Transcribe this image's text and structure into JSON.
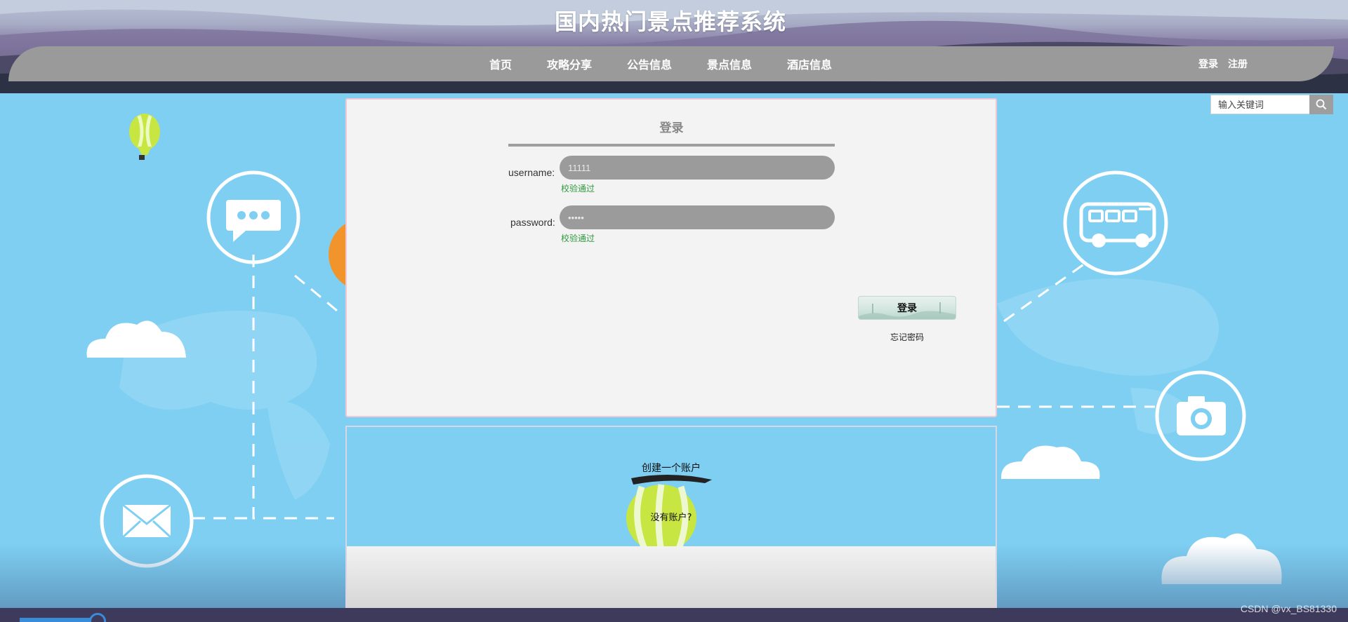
{
  "site": {
    "title": "国内热门景点推荐系统"
  },
  "nav": {
    "items": [
      {
        "label": "首页"
      },
      {
        "label": "攻略分享"
      },
      {
        "label": "公告信息"
      },
      {
        "label": "景点信息"
      },
      {
        "label": "酒店信息"
      }
    ],
    "login_label": "登录",
    "register_label": "注册"
  },
  "search": {
    "placeholder": "输入关键词",
    "icon": "search-icon"
  },
  "login": {
    "title": "登录",
    "username_label": "username:",
    "username_value": "11111",
    "username_hint": "校验通过",
    "password_label": "password:",
    "password_value": "•••••",
    "password_hint": "校验通过",
    "submit_label": "登录",
    "forgot_label": "忘记密码"
  },
  "register": {
    "create_label": "创建一个账户",
    "no_account_label": "没有账户?"
  },
  "watermark": "CSDN @vx_BS81330",
  "colors": {
    "sky": "#7ecff2",
    "nav": "#9a9a9a",
    "hint": "#2f9a3e",
    "accent": "#3a8cd9"
  }
}
